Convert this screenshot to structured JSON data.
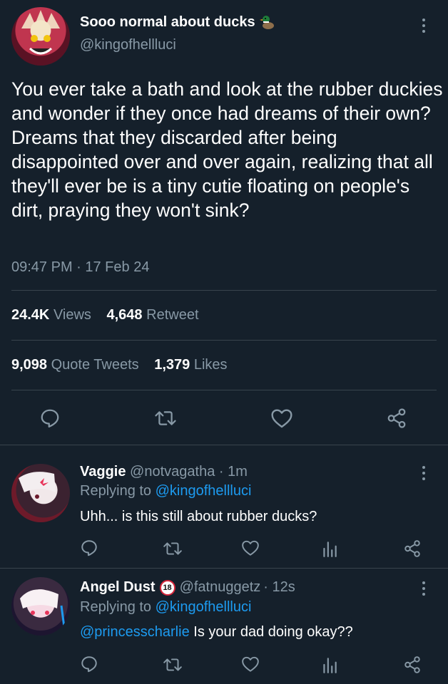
{
  "tweet": {
    "display_name": "Sooo normal about ducks",
    "emoji": "duck-emoji",
    "handle": "@kingofhellluci",
    "text": "You ever take a bath and look at the rubber duckies and wonder if they once had dreams of their own? Dreams that they discarded after being disappointed over and over again, realizing that all they'll ever be is a tiny cutie floating on people's dirt, praying they won't sink?",
    "time": "09:47 PM · 17 Feb 24",
    "views_count": "24.4K",
    "views_label": "Views",
    "retweet_count": "4,648",
    "retweet_label": "Retweet",
    "quote_count": "9,098",
    "quote_label": "Quote Tweets",
    "likes_count": "1,379",
    "likes_label": "Likes"
  },
  "replies": [
    {
      "name": "Vaggie",
      "handle": "@notvagatha",
      "time": "· 1m",
      "replying_prefix": "Replying to",
      "replying_to": "@kingofhellluci",
      "mention": "",
      "text": "Uhh... is this still about rubber ducks?"
    },
    {
      "name": "Angel Dust",
      "badge": "18",
      "handle": "@fatnuggetz",
      "time": "· 12s",
      "replying_prefix": "Replying to",
      "replying_to": "@kingofhellluci",
      "mention": "@princesscharlie",
      "text": "Is your dad doing okay??"
    }
  ],
  "colors": {
    "background": "#15202b",
    "muted": "#8899a6",
    "link": "#1d9bf0",
    "divider": "#38444d"
  },
  "icons": [
    "comment-icon",
    "retweet-icon",
    "heart-icon",
    "share-icon",
    "stats-icon",
    "more-icon"
  ]
}
